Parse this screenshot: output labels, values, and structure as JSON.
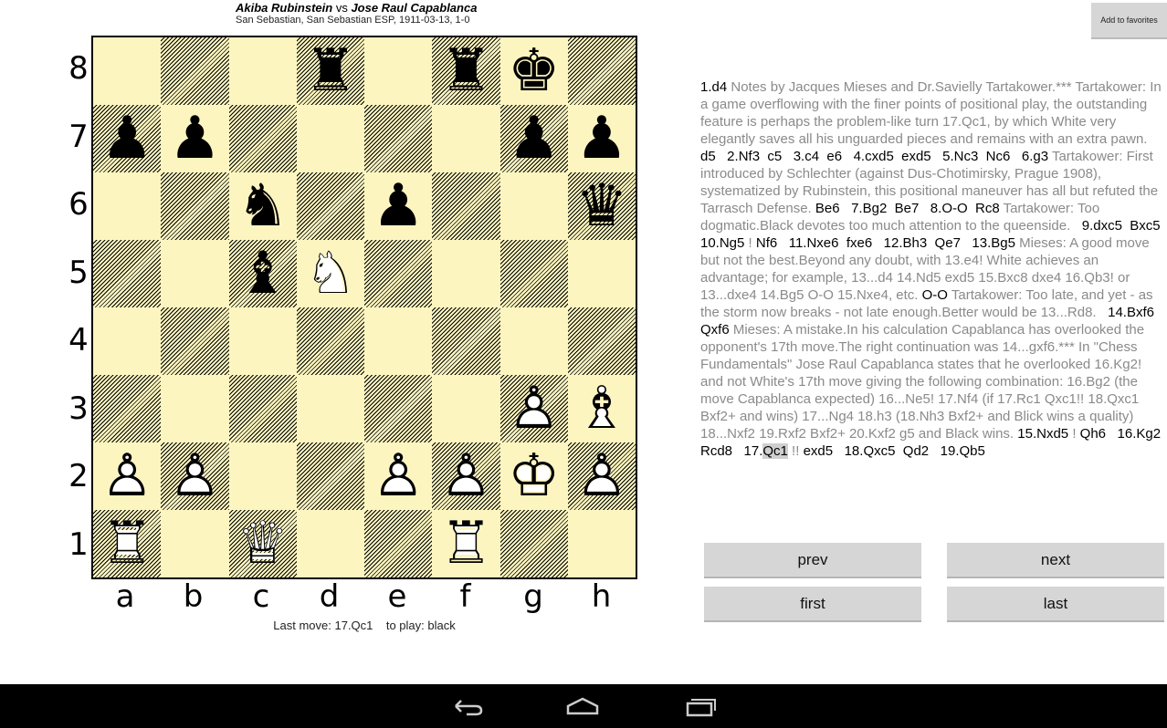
{
  "header": {
    "white": "Akiba Rubinstein",
    "vs": "vs",
    "black": "Jose Raul Capablanca",
    "subtitle": "San Sebastian, San Sebastian ESP, 1911-03-13, 1-0"
  },
  "favorites_label": "Add to favorites",
  "board": {
    "files": [
      "a",
      "b",
      "c",
      "d",
      "e",
      "f",
      "g",
      "h"
    ],
    "ranks": [
      "8",
      "7",
      "6",
      "5",
      "4",
      "3",
      "2",
      "1"
    ],
    "light_color": "#fdf5bf",
    "position": [
      [
        "",
        "",
        "",
        "bR",
        "",
        "bR",
        "bK",
        ""
      ],
      [
        "bP",
        "bP",
        "",
        "",
        "",
        "",
        "bP",
        "bP"
      ],
      [
        "",
        "",
        "bN",
        "",
        "bP",
        "",
        "",
        "bQ"
      ],
      [
        "",
        "",
        "bB",
        "wN",
        "",
        "",
        "",
        ""
      ],
      [
        "",
        "",
        "",
        "",
        "",
        "",
        "",
        ""
      ],
      [
        "",
        "",
        "",
        "",
        "",
        "",
        "wP",
        "wB"
      ],
      [
        "wP",
        "wP",
        "",
        "",
        "wP",
        "wP",
        "wK",
        "wP"
      ],
      [
        "wR",
        "",
        "wQ",
        "",
        "",
        "wR",
        "",
        ""
      ]
    ]
  },
  "status": "Last move: 17.Qc1    to play: black",
  "notation": [
    {
      "t": "1.d4 ",
      "k": "m"
    },
    {
      "t": "Notes by Jacques Mieses and Dr.Savielly Tartakower.*** Tartakower: In a game overflowing with the finer points of positional play, the outstanding feature is perhaps the problem-like turn 17.Qc1, by which White very elegantly saves all his unguarded pieces and remains with an extra pawn. ",
      "k": "c"
    },
    {
      "t": "d5   2.Nf3  c5   3.c4  e6   4.cxd5  exd5   5.Nc3  Nc6   6.g3 ",
      "k": "m"
    },
    {
      "t": "Tartakower: First introduced by Schlechter (against Dus-Chotimirsky, Prague 1908), systematized by Rubinstein, this positional maneuver has all but refuted the Tarrasch Defense. ",
      "k": "c"
    },
    {
      "t": "Be6   7.Bg2  Be7   8.O-O  Rc8 ",
      "k": "m"
    },
    {
      "t": "Tartakower: Too dogmatic.Black devotes too much attention to the queenside. ",
      "k": "c"
    },
    {
      "t": "  9.dxc5  Bxc5   10.Ng5 ",
      "k": "m"
    },
    {
      "t": "! ",
      "k": "n"
    },
    {
      "t": "Nf6   11.Nxe6  fxe6   12.Bh3  Qe7   13.Bg5 ",
      "k": "m"
    },
    {
      "t": "Mieses: A good move but not the best.Beyond any doubt, with 13.e4! White achieves an advantage; for example, 13...d4 14.Nd5 exd5 15.Bxc8 dxe4 16.Qb3! or 13...dxe4 14.Bg5 O-O 15.Nxe4, etc. ",
      "k": "c"
    },
    {
      "t": "O-O ",
      "k": "m"
    },
    {
      "t": "Tartakower: Too late, and yet - as the storm now breaks - not late enough.Better would be 13...Rd8. ",
      "k": "c"
    },
    {
      "t": "  14.Bxf6  Qxf6 ",
      "k": "m"
    },
    {
      "t": "Mieses: A mistake.In his calculation Capablanca has overlooked the opponent's 17th move.The right continuation was 14...gxf6.*** In \"Chess Fundamentals\" Jose Raul Capablanca states that he overlooked 16.Kg2! and not White's 17th move giving the following combination: 16.Bg2 (the move Capablanca expected) 16...Ne5! 17.Nf4 (if 17.Rc1 Qxc1!! 18.Qxc1 Bxf2+ and wins) 17...Ng4 18.h3 (18.Nh3 Bxf2+ and Blick wins a quality) 18...Nxf2 19.Rxf2 Bxf2+ 20.Kxf2 g5 and Black wins. ",
      "k": "c"
    },
    {
      "t": "15.Nxd5 ",
      "k": "m"
    },
    {
      "t": "! ",
      "k": "n"
    },
    {
      "t": "Qh6   16.Kg2  Rcd8   17.",
      "k": "m"
    },
    {
      "t": "Qc1",
      "k": "cur"
    },
    {
      "t": " !! ",
      "k": "n"
    },
    {
      "t": "exd5   18.Qxc5  Qd2   19.Qb5",
      "k": "m"
    }
  ],
  "buttons": {
    "prev": "prev",
    "next": "next",
    "first": "first",
    "last": "last"
  },
  "navbar": {
    "icons": [
      "back-icon",
      "home-icon",
      "recent-apps-icon"
    ]
  }
}
